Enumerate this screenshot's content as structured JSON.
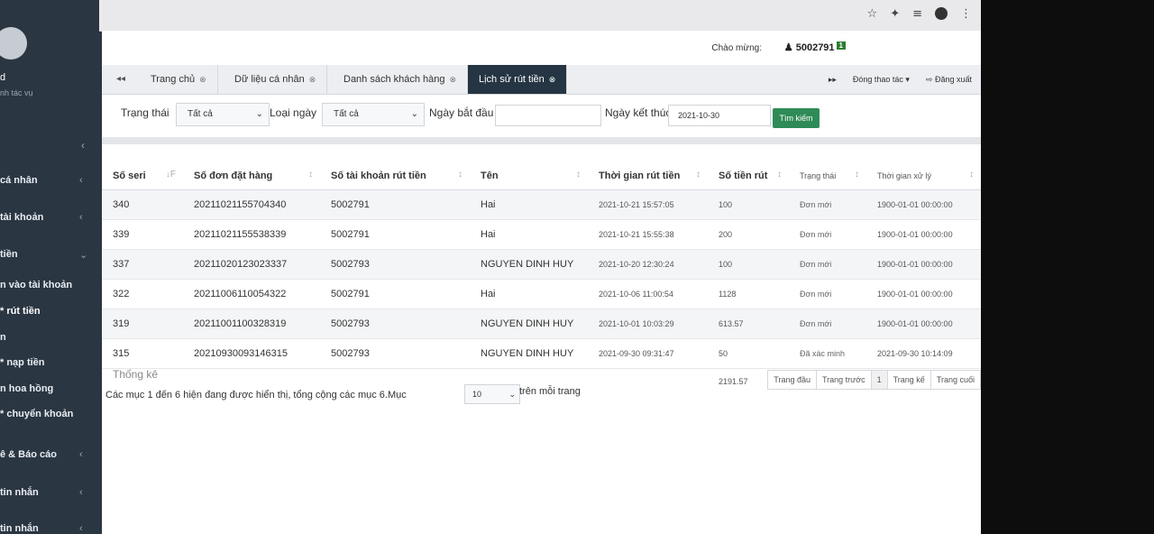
{
  "browser": {
    "icons": [
      "star-icon",
      "pin-icon",
      "queue-icon",
      "profile-icon",
      "menu-dots-icon"
    ]
  },
  "sidebar": {
    "user_name": "d",
    "user_sub": "nh tác vụ",
    "items": [
      {
        "label": "cá nhân",
        "chev": "‹"
      },
      {
        "label": "tài khoản",
        "chev": "‹"
      },
      {
        "label": "tiền",
        "chev": "⌄"
      },
      {
        "label": "n vào tài khoản",
        "chev": ""
      },
      {
        "label": "* rút tiền",
        "chev": ""
      },
      {
        "label": "n",
        "chev": ""
      },
      {
        "label": "* nạp tiền",
        "chev": ""
      },
      {
        "label": "n hoa hồng",
        "chev": ""
      },
      {
        "label": "* chuyển khoản",
        "chev": ""
      },
      {
        "label": "ê & Báo cáo",
        "chev": "‹"
      },
      {
        "label": "tin nhắn",
        "chev": "‹"
      },
      {
        "label": "tin nhắn",
        "chev": "‹"
      }
    ]
  },
  "header": {
    "welcome": "Chào mừng:",
    "user_id": "5002791",
    "badge": "1"
  },
  "tabs": {
    "nav_left": "◂◂",
    "items": [
      {
        "label": "Trang chủ"
      },
      {
        "label": "Dữ liệu cá nhân"
      },
      {
        "label": "Danh sách khách hàng"
      },
      {
        "label": "Lịch sử rút tiền"
      }
    ],
    "nav_right": "▸▸",
    "close_all": "Đóng thao tác ▾",
    "logout": "⇨ Đăng xuất"
  },
  "filters": {
    "status_label": "Trạng thái",
    "status_value": "Tất cả",
    "date_type_label": "Loại ngày",
    "date_type_value": "Tất cả",
    "start_label": "Ngày bắt đầu",
    "start_value": "",
    "end_label": "Ngày kết thúc",
    "end_value": "2021-10-30",
    "search_button": "Tìm kiếm"
  },
  "table": {
    "headers": [
      "Số seri",
      "Số đơn đặt hàng",
      "Số tài khoản rút tiền",
      "Tên",
      "Thời gian rút tiền",
      "Số tiền rút",
      "Trạng thái",
      "Thời gian xử lý"
    ],
    "rows": [
      [
        "340",
        "20211021155704340",
        "5002791",
        "Hai",
        "2021-10-21 15:57:05",
        "100",
        "Đơn mới",
        "1900-01-01 00:00:00"
      ],
      [
        "339",
        "20211021155538339",
        "5002791",
        "Hai",
        "2021-10-21 15:55:38",
        "200",
        "Đơn mới",
        "1900-01-01 00:00:00"
      ],
      [
        "337",
        "20211020123023337",
        "5002793",
        "NGUYEN DINH HUY",
        "2021-10-20 12:30:24",
        "100",
        "Đơn mới",
        "1900-01-01 00:00:00"
      ],
      [
        "322",
        "20211006110054322",
        "5002791",
        "Hai",
        "2021-10-06 11:00:54",
        "1128",
        "Đơn mới",
        "1900-01-01 00:00:00"
      ],
      [
        "319",
        "20211001100328319",
        "5002793",
        "NGUYEN DINH HUY",
        "2021-10-01 10:03:29",
        "613.57",
        "Đơn mới",
        "1900-01-01 00:00:00"
      ],
      [
        "315",
        "20210930093146315",
        "5002793",
        "NGUYEN DINH HUY",
        "2021-09-30 09:31:47",
        "50",
        "Đã xác minh",
        "2021-09-30 10:14:09"
      ]
    ],
    "total": "2191.57",
    "stats_label": "Thống kê"
  },
  "paging": {
    "info": "Các mục 1 đến 6 hiện đang được hiển thị, tổng cộng các mục 6.Mục",
    "page_size": "10",
    "suffix": "trên mỗi trang",
    "first": "Trang đầu",
    "prev": "Trang trước",
    "current": "1",
    "next": "Trang kế",
    "last": "Trang cuối"
  }
}
